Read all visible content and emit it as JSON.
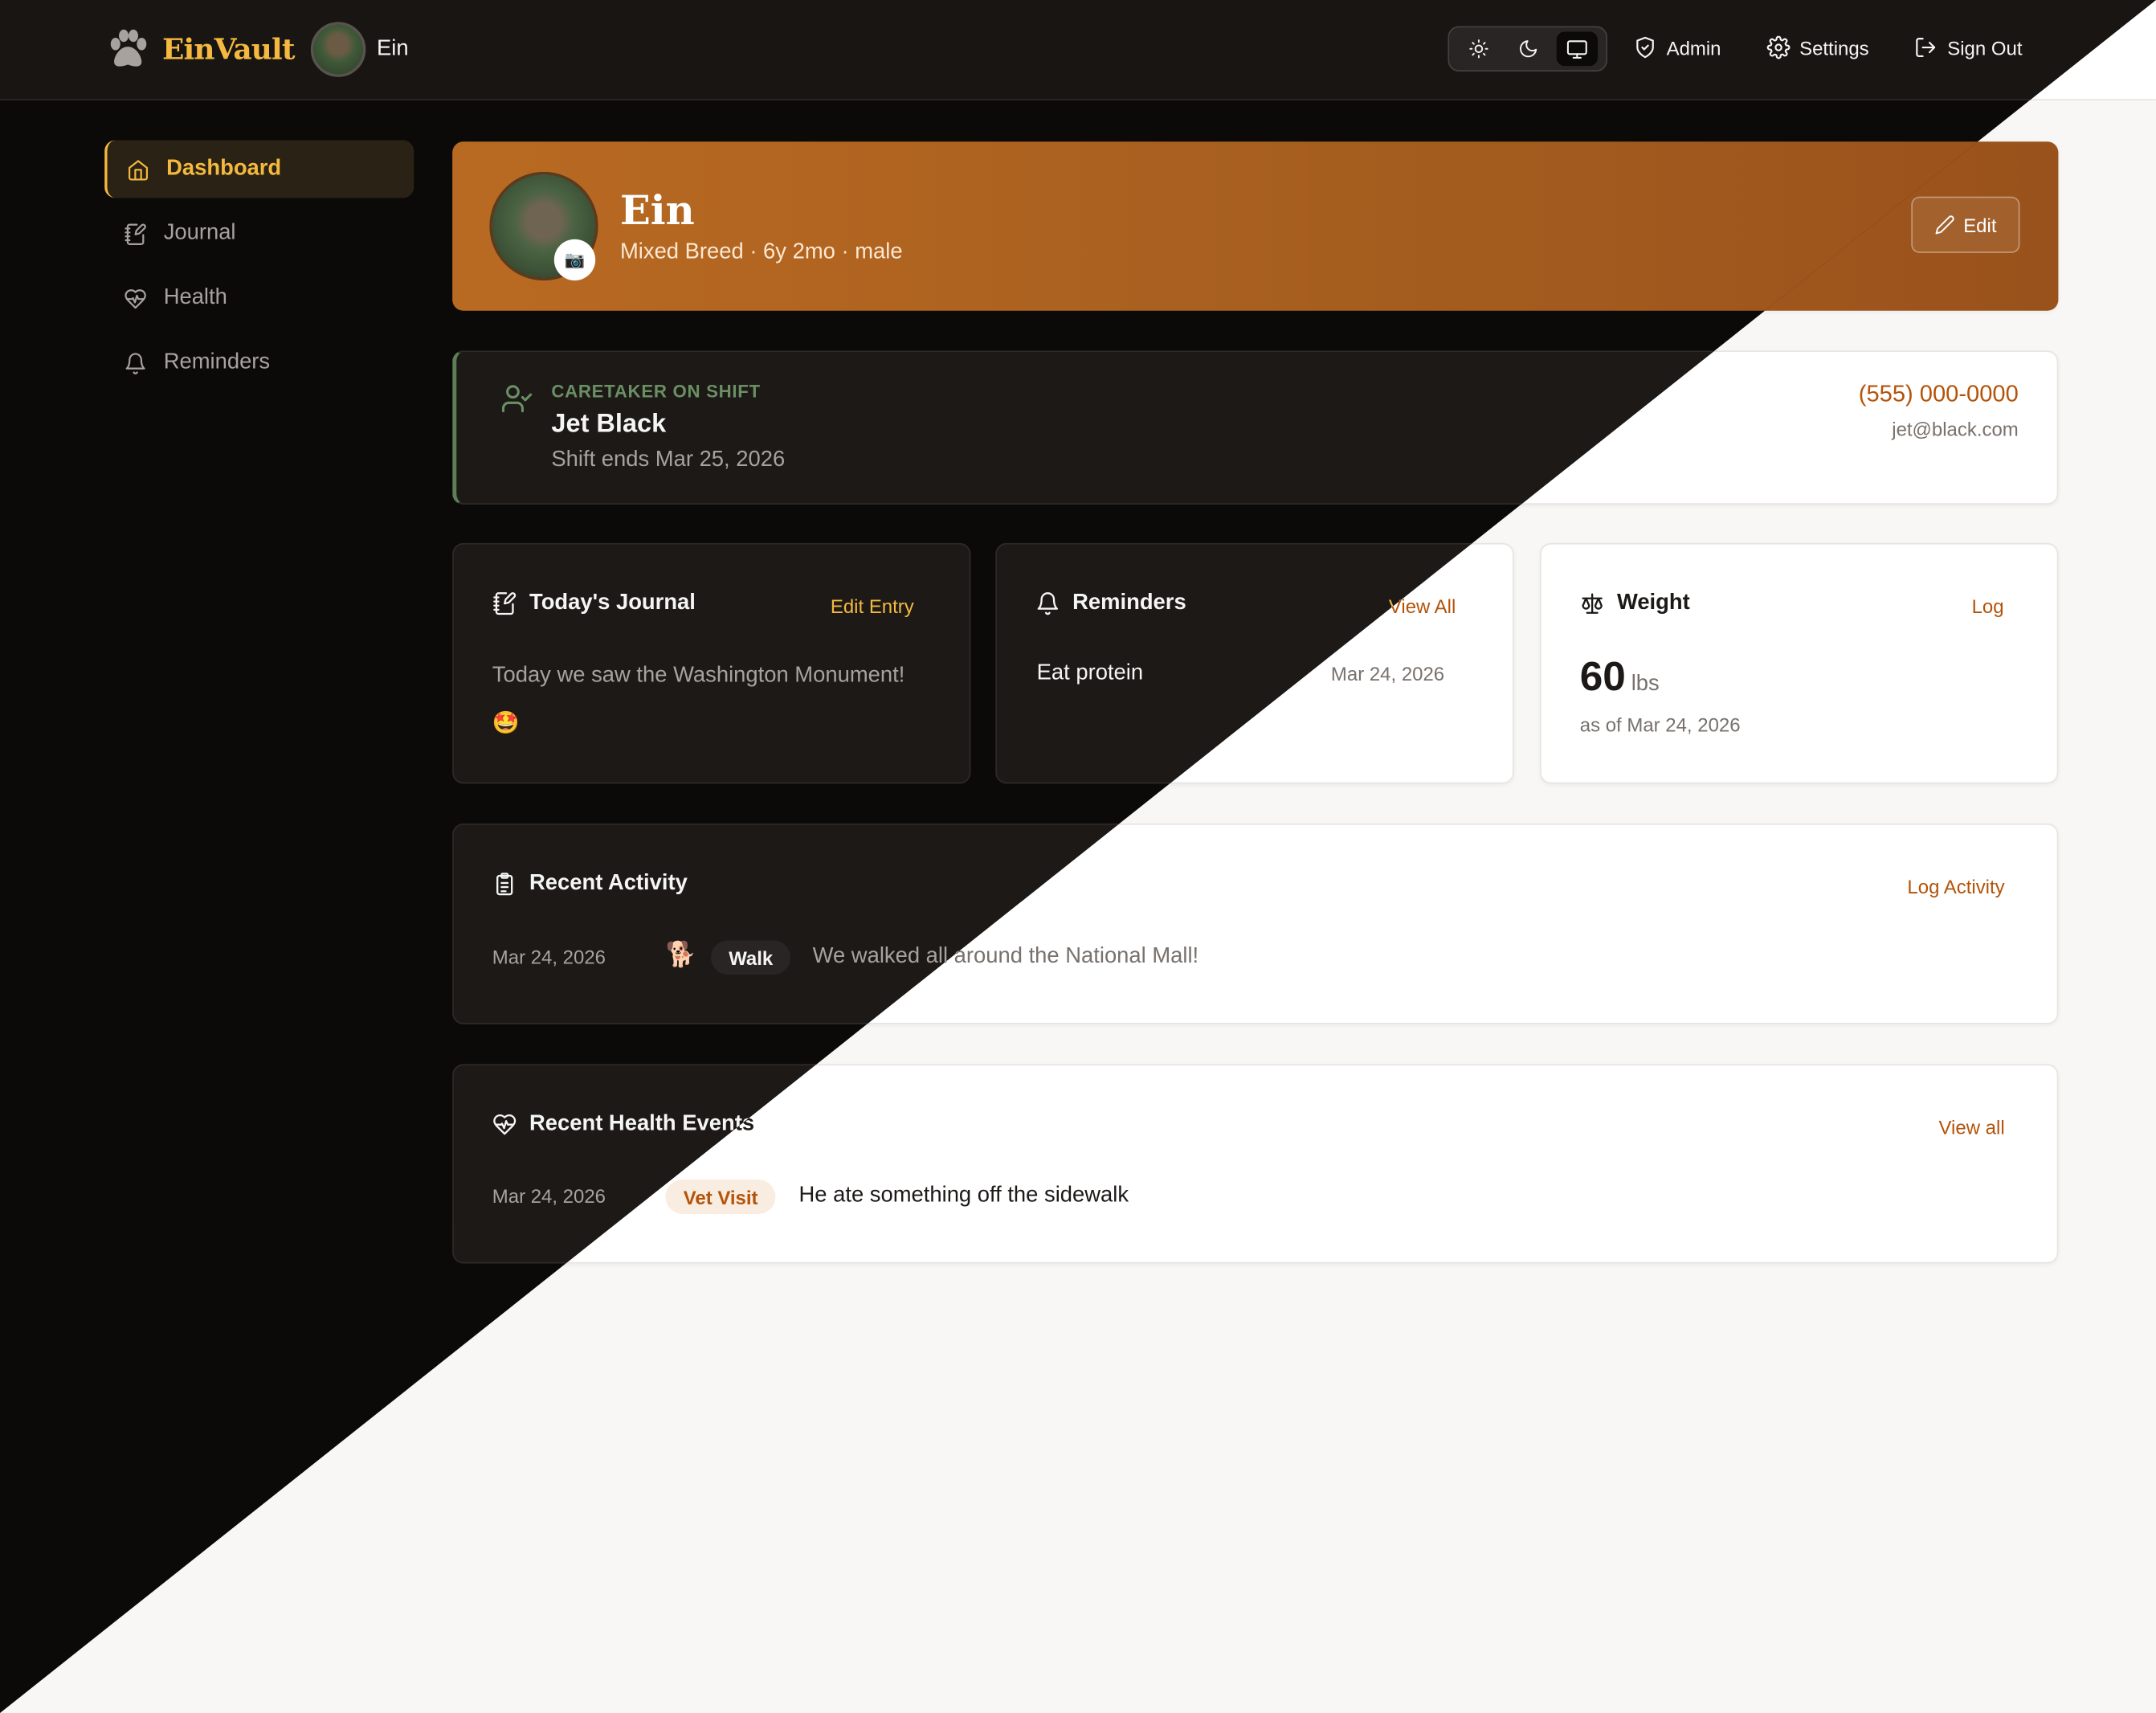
{
  "app": {
    "name": "EinVault",
    "pet_name": "Ein"
  },
  "nav": {
    "admin": "Admin",
    "settings": "Settings",
    "sign_out": "Sign Out",
    "theme_modes": [
      "light",
      "dark",
      "system"
    ],
    "theme_active": "system"
  },
  "sidebar": {
    "items": [
      {
        "label": "Dashboard",
        "icon": "home-icon",
        "active": true
      },
      {
        "label": "Journal",
        "icon": "notebook-pen-icon"
      },
      {
        "label": "Health",
        "icon": "heart-pulse-icon"
      },
      {
        "label": "Reminders",
        "icon": "bell-icon"
      }
    ]
  },
  "profile": {
    "name": "Ein",
    "subtitle": "Mixed Breed · 6y 2mo · male",
    "edit_label": "Edit",
    "camera_icon": "📷"
  },
  "caretaker": {
    "label": "CARETAKER ON SHIFT",
    "name": "Jet Black",
    "shift_end": "Shift ends Mar 25, 2026",
    "phone": "(555) 000-0000",
    "email": "jet@black.com"
  },
  "journal": {
    "title": "Today's Journal",
    "action": "Edit Entry",
    "text": "Today we saw the Washington Monument!",
    "emoji": "🤩"
  },
  "reminders": {
    "title": "Reminders",
    "action": "View All",
    "items": [
      {
        "title": "Eat protein",
        "date": "Mar 24, 2026"
      }
    ]
  },
  "weight": {
    "title": "Weight",
    "action": "Log",
    "value": "60",
    "unit": "lbs",
    "as_of": "as of Mar 24, 2026"
  },
  "activity": {
    "title": "Recent Activity",
    "action": "Log Activity",
    "items": [
      {
        "date": "Mar 24, 2026",
        "icon": "🐕",
        "type": "Walk",
        "note": "We walked all around the National Mall!"
      }
    ]
  },
  "health": {
    "title": "Recent Health Events",
    "action": "View all",
    "items": [
      {
        "date": "Mar 24, 2026",
        "type": "Vet Visit",
        "note": "He ate something off the sidewalk"
      }
    ]
  },
  "colors": {
    "accent_light": "#b45309",
    "accent_dark": "#f4b93e",
    "hero_gradient_start": "#b96a22",
    "hero_gradient_end": "#9a521c",
    "caretaker_green": "#6b8f63"
  }
}
